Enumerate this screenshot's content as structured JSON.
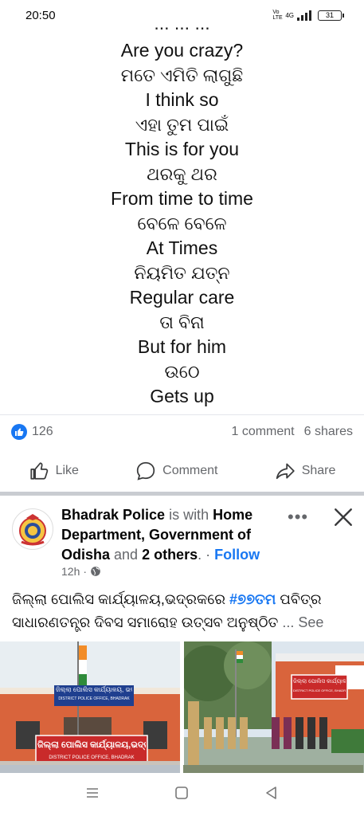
{
  "status_bar": {
    "time": "20:50",
    "network": "4G",
    "volte": "Vo LTE",
    "battery": "31"
  },
  "post1": {
    "partial_line": "... ... ...",
    "lines": [
      {
        "text": "Are you crazy?",
        "lang": "en"
      },
      {
        "text": "ମତେ ଏମିତି ଲାଗୁଛି",
        "lang": "or"
      },
      {
        "text": "I think so",
        "lang": "en"
      },
      {
        "text": "ଏହା ତୁମ ପାଇଁ",
        "lang": "or"
      },
      {
        "text": "This is for you",
        "lang": "en"
      },
      {
        "text": "ଥରକୁ ଥର",
        "lang": "or"
      },
      {
        "text": "From time to time",
        "lang": "en"
      },
      {
        "text": "ବେଳେ ବେଳେ",
        "lang": "or"
      },
      {
        "text": "At Times",
        "lang": "en"
      },
      {
        "text": "ନିୟମିତ ଯତ୍ନ",
        "lang": "or"
      },
      {
        "text": "Regular care",
        "lang": "en"
      },
      {
        "text": "ତା ବିନା",
        "lang": "or"
      },
      {
        "text": "But for him",
        "lang": "en"
      },
      {
        "text": "ଉଠେ",
        "lang": "or"
      },
      {
        "text": "Gets up",
        "lang": "en"
      }
    ],
    "reactions": {
      "likes": "126",
      "comments": "1 comment",
      "shares": "6 shares"
    },
    "actions": {
      "like": "Like",
      "comment": "Comment",
      "share": "Share"
    }
  },
  "post2": {
    "page_name": "Bhadrak Police",
    "is_with": " is with ",
    "tagged": "Home Department, Government of Odisha",
    "and_text": " and ",
    "others": "2 others",
    "dot": ". · ",
    "follow": "Follow",
    "time": "12h",
    "text_before": "ଜିଲ୍ଲା ପୋଲିସ କାର୍ଯ୍ୟାଳୟ,ଭଦ୍ରକରେ ",
    "hashtag": "#୭୭ତମ",
    "text_after": " ପବିତ୍ର ସାଧାରଣତନ୍ତ୍ର ଦିବସ ସମାରୋହ ଉତ୍ସବ ଅନୁଷ୍ଠିତ ",
    "see_more": "... See more",
    "photo1_sign_top": "ଜିଲ୍ଲା ପୋଲିସ କାର୍ଯ୍ୟାଳୟ, ଭଦ୍ରକ",
    "photo1_sign_top_en": "DISTRICT POLICE OFFICE, BHADRAK",
    "photo1_sign_bottom": "ଜିଲ୍ଲା ପୋଲିସ କାର୍ଯ୍ୟାଳୟ,ଭଦ୍ରକ",
    "photo1_sign_bottom_en": "DISTRICT POLICE OFFICE, BHADRAK",
    "photo2_sign": "ଜିଲ୍ଲା ପୋଲିସ କାର୍ଯ୍ୟାଳୟ, ଭଦ୍ରକ",
    "photo2_sign_en": "DISTRICT POLICE OFFICE, BHADRAK"
  },
  "colors": {
    "facebook_blue": "#1877f2",
    "secondary_text": "#65676b",
    "divider": "#c9ccd1"
  },
  "icons": {
    "like": "thumbs-up-icon",
    "comment": "speech-bubble-icon",
    "share": "share-arrow-icon",
    "more": "more-dots-icon",
    "close": "close-icon",
    "globe": "globe-icon",
    "nav_menu": "menu-icon",
    "nav_home": "home-square-icon",
    "nav_back": "back-triangle-icon"
  }
}
